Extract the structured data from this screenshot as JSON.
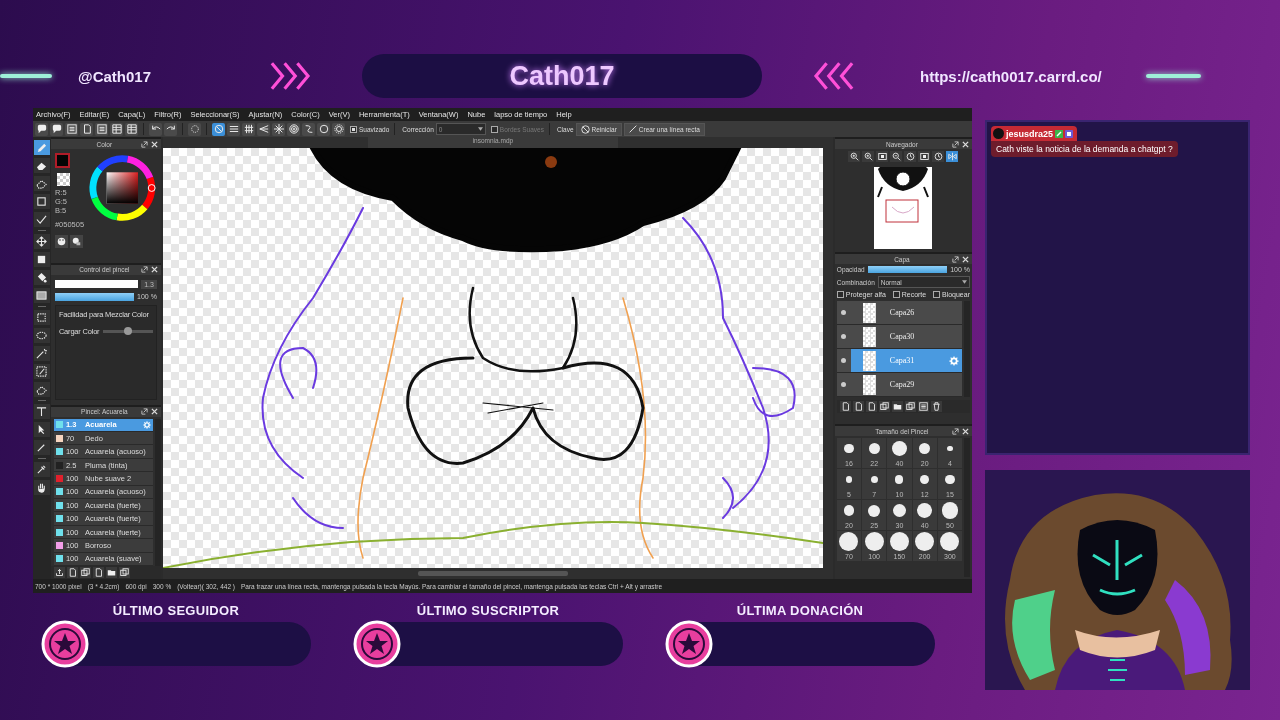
{
  "header": {
    "handle": "@Cath017",
    "title": "Cath017",
    "url": "https://cath0017.carrd.co/"
  },
  "app": {
    "menu": [
      "Archivo(F)",
      "Editar(E)",
      "Capa(L)",
      "Filtro(R)",
      "Seleccionar(S)",
      "Ajustar(N)",
      "Color(C)",
      "Ver(V)",
      "Herramienta(T)",
      "Ventana(W)",
      "Nube",
      "lapso de tiempo",
      "Help"
    ],
    "toolbar": {
      "snap_buttons": [
        {
          "selected": true
        },
        {
          "selected": false
        },
        {
          "selected": false
        },
        {
          "selected": false
        },
        {
          "selected": false
        },
        {
          "selected": false
        },
        {
          "selected": false
        },
        {
          "selected": false
        },
        {
          "selected": false
        }
      ],
      "smoothing": {
        "label": "Suavizado",
        "checked": true
      },
      "correction": {
        "label": "Corrección",
        "value": "0"
      },
      "soft_edges": {
        "label": "Bordes Suaves",
        "checked": false,
        "disabled": true
      },
      "key_label": "Clave",
      "reset_button": "Reiniciar",
      "line_button": "Crear una línea recta"
    },
    "tools": [
      {
        "selected": true
      },
      {
        "selected": false
      },
      {
        "selected": false
      },
      {
        "selected": false
      },
      {
        "selected": false
      },
      {
        "selected": false
      },
      {
        "selected": false
      },
      {
        "selected": false
      },
      {
        "selected": false
      },
      {
        "selected": false
      },
      {
        "selected": false
      },
      {
        "selected": false
      },
      {
        "selected": false
      },
      {
        "selected": false
      },
      {
        "selected": false
      },
      {
        "selected": false
      },
      {
        "selected": false
      },
      {
        "selected": false
      },
      {
        "selected": false
      }
    ],
    "color_panel": {
      "title": "Color",
      "rgb": [
        "R:5",
        "G:5",
        "B:5"
      ],
      "hex": "#050505"
    },
    "brush_control": {
      "title": "Control del pincel",
      "size": {
        "value": "1.3",
        "level": 1
      },
      "opacity": {
        "value": "100 %",
        "level": 1
      },
      "blend_label": "Facilidad para Mezclar Color",
      "load": {
        "label": "Cargar Color",
        "level": 0.5
      }
    },
    "brush_list": {
      "title": "Pincel: Acuarela",
      "items": [
        {
          "color": "#6fe0ec",
          "size": "1.3",
          "name": "Acuarela",
          "selected": true
        },
        {
          "color": "#f6d5c0",
          "size": "70",
          "name": "Dedo",
          "selected": false
        },
        {
          "color": "#6fe0ec",
          "size": "100",
          "name": "Acuarela (acuoso)",
          "selected": false
        },
        {
          "color": "#222222",
          "size": "2.5",
          "name": "Pluma (tinta)",
          "selected": false
        },
        {
          "color": "#e0202c",
          "size": "100",
          "name": "Nube suave 2",
          "selected": false
        },
        {
          "color": "#6fe0ec",
          "size": "100",
          "name": "Acuarela (acuoso)",
          "selected": false
        },
        {
          "color": "#6fe0ec",
          "size": "100",
          "name": "Acuarela (fuerte)",
          "selected": false
        },
        {
          "color": "#6fe0ec",
          "size": "100",
          "name": "Acuarela (fuerte)",
          "selected": false
        },
        {
          "color": "#6fe0ec",
          "size": "100",
          "name": "Acuarela (fuerte)",
          "selected": false
        },
        {
          "color": "#f29ee8",
          "size": "100",
          "name": "Borroso",
          "selected": false
        },
        {
          "color": "#6fe0ec",
          "size": "100",
          "name": "Acuarela (suave)",
          "selected": false
        }
      ]
    },
    "canvas": {
      "tab": "insomnia.mdp"
    },
    "navigator": {
      "title": "Navegador"
    },
    "layers": {
      "title": "Capa",
      "opacity": {
        "label": "Opacidad",
        "value": "100 %",
        "level": 1
      },
      "blend": {
        "label": "Combinación",
        "value": "Normal"
      },
      "options": [
        {
          "label": "Proteger alfa",
          "checked": false
        },
        {
          "label": "Recorte",
          "checked": false
        },
        {
          "label": "Bloquear",
          "checked": false
        }
      ],
      "items": [
        {
          "name": "Capa26",
          "selected": false
        },
        {
          "name": "Capa30",
          "selected": false
        },
        {
          "name": "Capa31",
          "selected": true
        },
        {
          "name": "Capa29",
          "selected": false
        }
      ]
    },
    "brush_sizes": {
      "title": "Tamaño del Pincel",
      "sizes": [
        "16",
        "22",
        "40",
        "20",
        "4",
        "5",
        "7",
        "10",
        "12",
        "15",
        "20",
        "25",
        "30",
        "40",
        "50",
        "70",
        "100",
        "150",
        "200",
        "300"
      ]
    },
    "status_bar": [
      "700 * 1000 pixel",
      "(3 * 4.2cm)",
      "600 dpi",
      "300 %",
      "(Voltear)( 302, 442 )",
      "Para trazar una línea recta, mantenga pulsada la tecla Mayús. Para cambiar el tamaño del pincel, mantenga pulsada las teclas Ctrl + Alt y arrastre"
    ]
  },
  "chat": {
    "messages": [
      {
        "user": "jesusdra25",
        "text": "Cath viste la noticia de la demanda a chatgpt ?"
      }
    ]
  },
  "widgets": [
    "ÚLTIMO SEGUIDOR",
    "ÚLTIMO SUSCRIPTOR",
    "ÚLTIMA DONACIÓN"
  ]
}
